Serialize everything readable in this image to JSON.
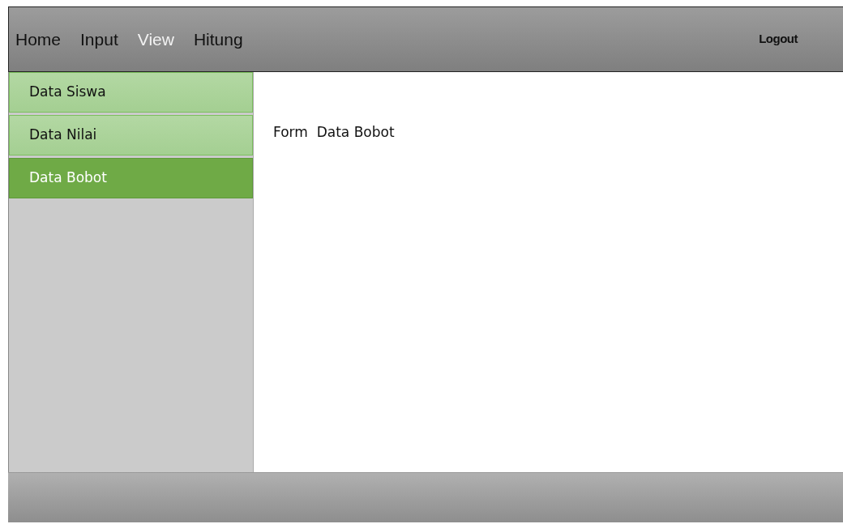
{
  "top_menu": [
    {
      "label": "Home",
      "selected": false
    },
    {
      "label": "Input",
      "selected": false
    },
    {
      "label": "View",
      "selected": true
    },
    {
      "label": "Hitung",
      "selected": false
    }
  ],
  "logout": "Logout",
  "sidebar": {
    "items": [
      {
        "label": "Data Siswa",
        "selected": false
      },
      {
        "label": "Data Nilai",
        "selected": false
      },
      {
        "label": "Data Bobot",
        "selected": true
      }
    ]
  },
  "content": {
    "title": "Form  Data Bobot"
  }
}
